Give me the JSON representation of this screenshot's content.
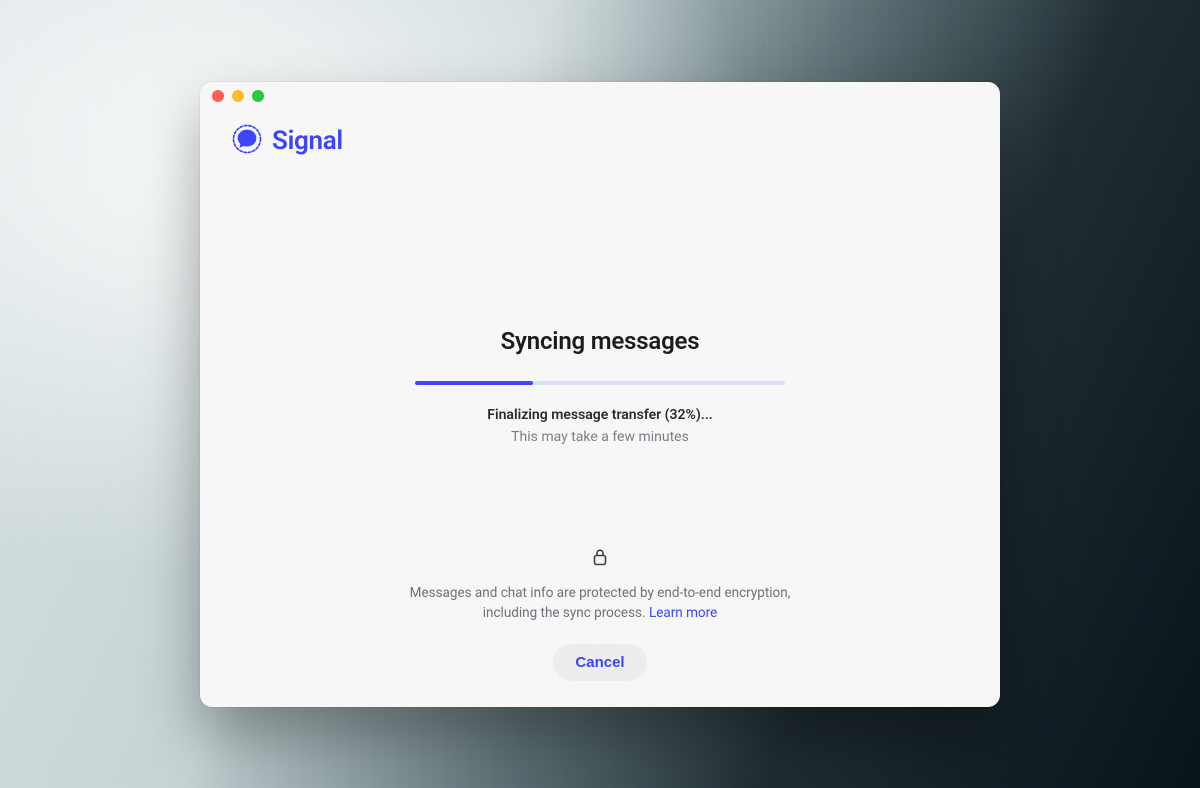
{
  "brand": {
    "name": "Signal",
    "color": "#3B45FD"
  },
  "sync": {
    "heading": "Syncing messages",
    "progress_percent": 32,
    "status_primary": "Finalizing message transfer (32%)...",
    "status_secondary": "This may take a few minutes"
  },
  "footer": {
    "encryption_text": "Messages and chat info are protected by end-to-end encryption, including the sync process. ",
    "learn_more_label": "Learn more"
  },
  "buttons": {
    "cancel_label": "Cancel"
  },
  "colors": {
    "accent": "#3B45FD",
    "progress_track": "#dbe1f5"
  }
}
